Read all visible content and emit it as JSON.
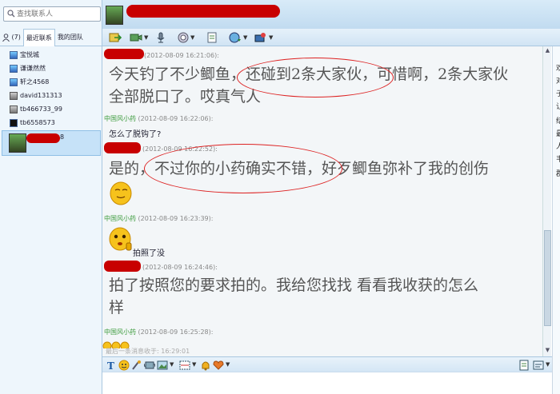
{
  "search": {
    "placeholder": "查找联系人"
  },
  "tabs": [
    {
      "label": "(7)"
    },
    {
      "label": "最近联系"
    },
    {
      "label": "我的团队"
    }
  ],
  "contacts": [
    {
      "name": "宝悦城"
    },
    {
      "name": "谦谦然然"
    },
    {
      "name": "轩之4568"
    },
    {
      "name": "david131313"
    },
    {
      "name": "tb466733_99"
    },
    {
      "name": "tb6558573"
    }
  ],
  "selected_contact": {
    "suffix": "8"
  },
  "messages": [
    {
      "time": "(2012-08-09 16:21:06):",
      "lines": [
        "今天钓了不少鲫鱼，还碰到2条大家伙，可惜啊，2条大家伙",
        "全部脱口了。哎真气人"
      ]
    },
    {
      "sender": "中国风小药",
      "time": "(2012-08-09 16:22:06):",
      "text": "怎么了脱钩了?"
    },
    {
      "time": "(2012-08-09 16:22:52):",
      "lines": [
        "是的，不过你的小药确实不错，好歹鲫鱼弥补了我的创伤"
      ]
    },
    {
      "sender": "中国风小药",
      "time": "(2012-08-09 16:23:39):",
      "text": "拍照了没"
    },
    {
      "time": "(2012-08-09 16:24:46):",
      "lines": [
        "拍了按照您的要求拍的。我给您找找  看看我收获的怎么",
        "样"
      ]
    },
    {
      "sender": "中国风小药",
      "time": "(2012-08-09 16:25:28):"
    }
  ],
  "last_message": "最后一条消息收于: 16:29:01",
  "side_chars": [
    "欢",
    "对",
    "子",
    "让",
    "结",
    "最",
    "人",
    "韦",
    "郡"
  ],
  "scroll": {
    "position_fraction": 0.6
  }
}
